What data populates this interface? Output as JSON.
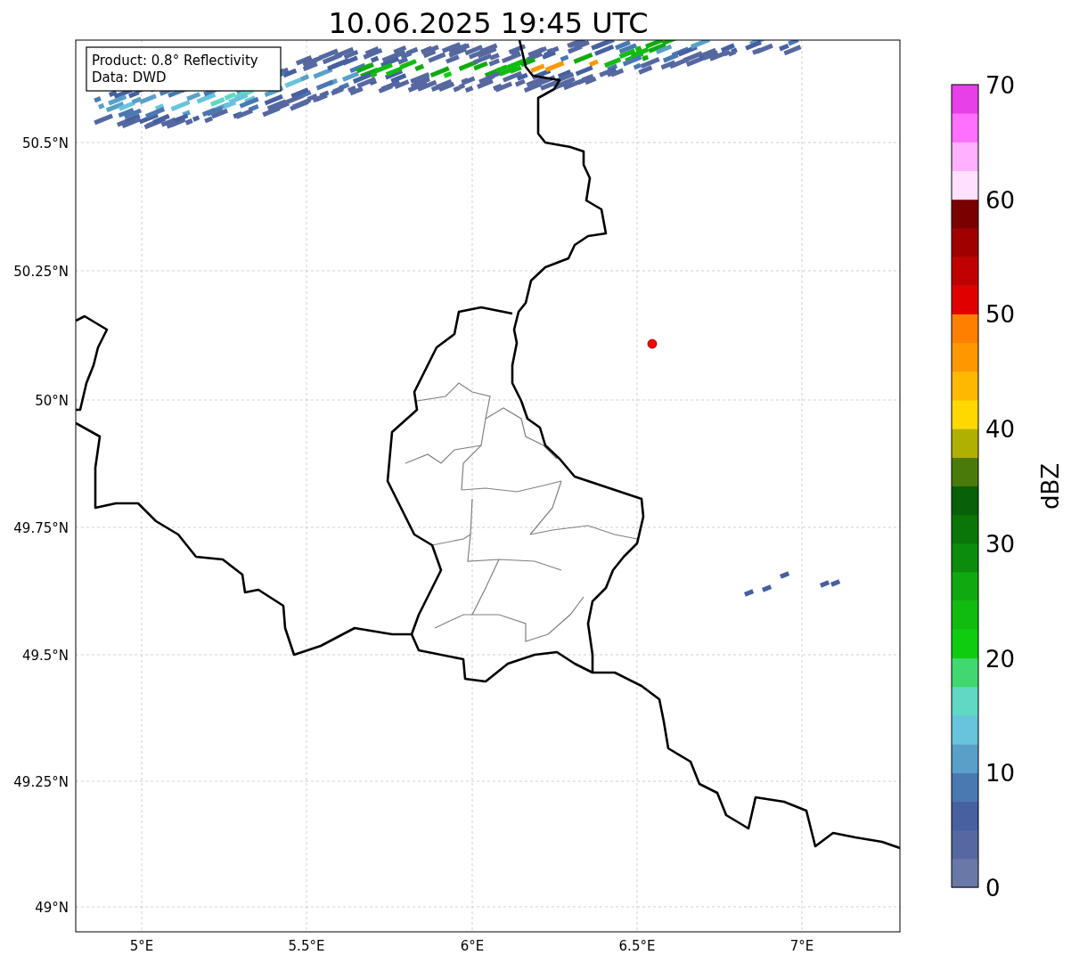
{
  "title": "10.06.2025 19:45 UTC",
  "info_box": [
    "Product: 0.8° Reflectivity",
    "Data: DWD"
  ],
  "y_ticks": [
    "50.5°N",
    "50.25°N",
    "50°N",
    "49.75°N",
    "49.5°N",
    "49.25°N",
    "49°N"
  ],
  "x_ticks": [
    "5°E",
    "5.5°E",
    "6°E",
    "6.5°E",
    "7°E"
  ],
  "colorbar": {
    "label": "dBZ",
    "ticks": [
      "70",
      "60",
      "50",
      "40",
      "30",
      "20",
      "10",
      "0"
    ],
    "bands": [
      {
        "color": "#6a78a8"
      },
      {
        "color": "#5668a0"
      },
      {
        "color": "#4660a0"
      },
      {
        "color": "#4a78b0"
      },
      {
        "color": "#58a0c8"
      },
      {
        "color": "#68c4dc"
      },
      {
        "color": "#60d8c4"
      },
      {
        "color": "#40d870"
      },
      {
        "color": "#10cc10"
      },
      {
        "color": "#10bc10"
      },
      {
        "color": "#10aa10"
      },
      {
        "color": "#0c8c0c"
      },
      {
        "color": "#0a760a"
      },
      {
        "color": "#086008"
      },
      {
        "color": "#4a7a0a"
      },
      {
        "color": "#b0b000"
      },
      {
        "color": "#ffd800"
      },
      {
        "color": "#ffb800"
      },
      {
        "color": "#ff9800"
      },
      {
        "color": "#ff7f00"
      },
      {
        "color": "#e00000"
      },
      {
        "color": "#c00000"
      },
      {
        "color": "#a00000"
      },
      {
        "color": "#7a0000"
      },
      {
        "color": "#ffe0ff"
      },
      {
        "color": "#ffb0ff"
      },
      {
        "color": "#ff70ff"
      },
      {
        "color": "#e840e8"
      }
    ]
  }
}
